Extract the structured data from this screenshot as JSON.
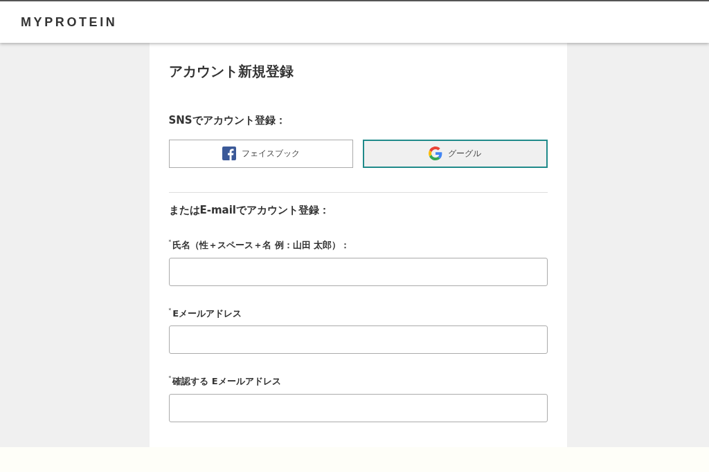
{
  "header": {
    "logo": "MYPROTEIN"
  },
  "form": {
    "title": "アカウント新規登録",
    "sns_heading": "SNSでアカウント登録：",
    "sns_buttons": [
      {
        "kind": "facebook",
        "label": "フェイスブック",
        "selected": false
      },
      {
        "kind": "google",
        "label": "グーグル",
        "selected": true
      }
    ],
    "email_heading": "またはE-mailでアカウント登録：",
    "fields": [
      {
        "required_mark": "*",
        "label": "氏名（性＋スペース＋名 例：山田 太郎）："
      },
      {
        "required_mark": "*",
        "label": "Eメールアドレス"
      },
      {
        "required_mark": "*",
        "label": "確認する Eメールアドレス"
      }
    ]
  }
}
